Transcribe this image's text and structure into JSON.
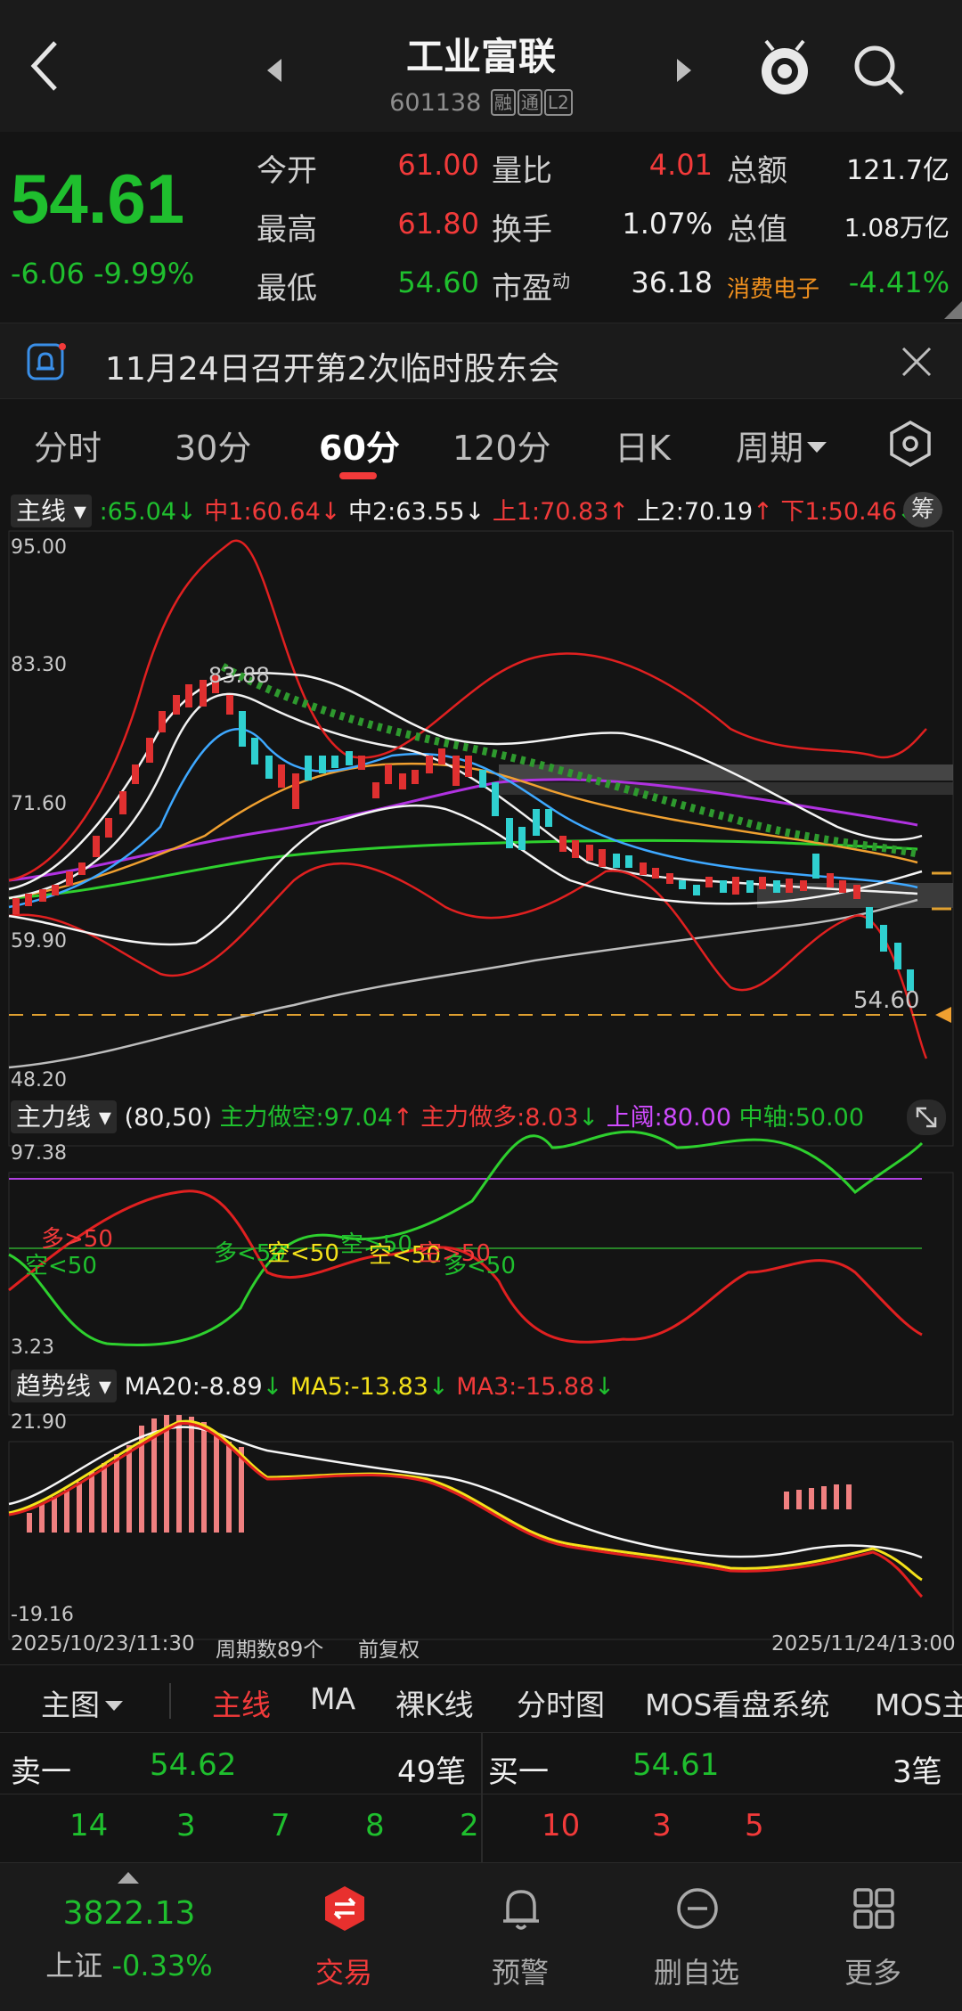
{
  "header": {
    "title": "工业富联",
    "code": "601138",
    "tags": [
      "融",
      "通",
      "L2"
    ]
  },
  "quote": {
    "price": "54.61",
    "change": "-6.06",
    "change_pct": "-9.99%",
    "stats": [
      {
        "label": "今开",
        "value": "61.00",
        "color": "red"
      },
      {
        "label": "最高",
        "value": "61.80",
        "color": "red"
      },
      {
        "label": "最低",
        "value": "54.60",
        "color": "green"
      },
      {
        "label": "量比",
        "value": "4.01",
        "color": "red"
      },
      {
        "label": "换手",
        "value": "1.07%",
        "color": "white"
      },
      {
        "label": "市盈",
        "value": "36.18",
        "color": "white",
        "sup": "动"
      },
      {
        "label": "总额",
        "value": "121.7亿",
        "color": "white"
      },
      {
        "label": "总值",
        "value": "1.08万亿",
        "color": "white"
      }
    ],
    "sector": "消费电子",
    "sector_change": "-4.41%"
  },
  "notice": {
    "text": "11月24日召开第2次临时股东会"
  },
  "tabs": [
    "分时",
    "30分",
    "60分",
    "120分",
    "日K",
    "周期"
  ],
  "active_tab": "60分",
  "main_indicator": {
    "name": "主线",
    "values": [
      {
        "label": ":65.04",
        "arrow": "↓",
        "color": "green"
      },
      {
        "label": "中1:60.64",
        "arrow": "↓",
        "color": "red"
      },
      {
        "label": "中2:63.55",
        "arrow": "↓",
        "color": "white"
      },
      {
        "label": "上1:70.83",
        "arrow": "↑",
        "color": "red"
      },
      {
        "label": "上2:70.19",
        "arrow": "↑",
        "color": "white"
      },
      {
        "label": "下1:50.46",
        "arrow": "↓",
        "color": "red"
      }
    ],
    "chip_btn": "筹",
    "y_labels": [
      "95.00",
      "83.30",
      "71.60",
      "59.90",
      "48.20"
    ],
    "high_label": "83.88",
    "last_label": "54.60"
  },
  "power_indicator": {
    "name": "主力线",
    "params": "(80,50)",
    "values": [
      {
        "label": "主力做空:97.04",
        "arrow": "↑",
        "color": "green"
      },
      {
        "label": "主力做多:8.03",
        "arrow": "↓",
        "color": "red"
      },
      {
        "label": "上阈:80.00",
        "arrow": "",
        "color": "magenta"
      },
      {
        "label": "中轴:50.00",
        "arrow": "",
        "color": "green"
      }
    ],
    "y_labels": [
      "97.38",
      "3.23"
    ],
    "annotations": [
      "多>50",
      "空<50",
      "多<50",
      "空<50",
      "空>50",
      "空<50",
      "空>50",
      "多<50"
    ]
  },
  "trend_indicator": {
    "name": "趋势线",
    "values": [
      {
        "label": "MA20:-8.89",
        "arrow": "↓",
        "color": "white"
      },
      {
        "label": "MA5:-13.83",
        "arrow": "↓",
        "color": "yellow"
      },
      {
        "label": "MA3:-15.88",
        "arrow": "↓",
        "color": "red"
      }
    ],
    "y_labels": [
      "21.90",
      "-19.16"
    ]
  },
  "chart_footer": {
    "start": "2025/10/23/11:30",
    "periods": "周期数89个",
    "adjust": "前复权",
    "end": "2025/11/24/13:00"
  },
  "main_tabs": [
    "主图",
    "主线",
    "MA",
    "裸K线",
    "分时图",
    "MOS看盘系统",
    "MOS主"
  ],
  "orderbook": {
    "sell_label": "卖一",
    "sell_price": "54.62",
    "sell_count": "49笔",
    "buy_label": "买一",
    "buy_price": "54.61",
    "buy_count": "3笔",
    "sell_ticks": [
      "14",
      "3",
      "7",
      "8",
      "2"
    ],
    "buy_ticks": [
      "10",
      "3",
      "5"
    ]
  },
  "bottom_nav": {
    "index_value": "3822.13",
    "index_name": "上证",
    "index_change": "-0.33%",
    "items": [
      "交易",
      "预警",
      "删自选",
      "更多"
    ]
  }
}
